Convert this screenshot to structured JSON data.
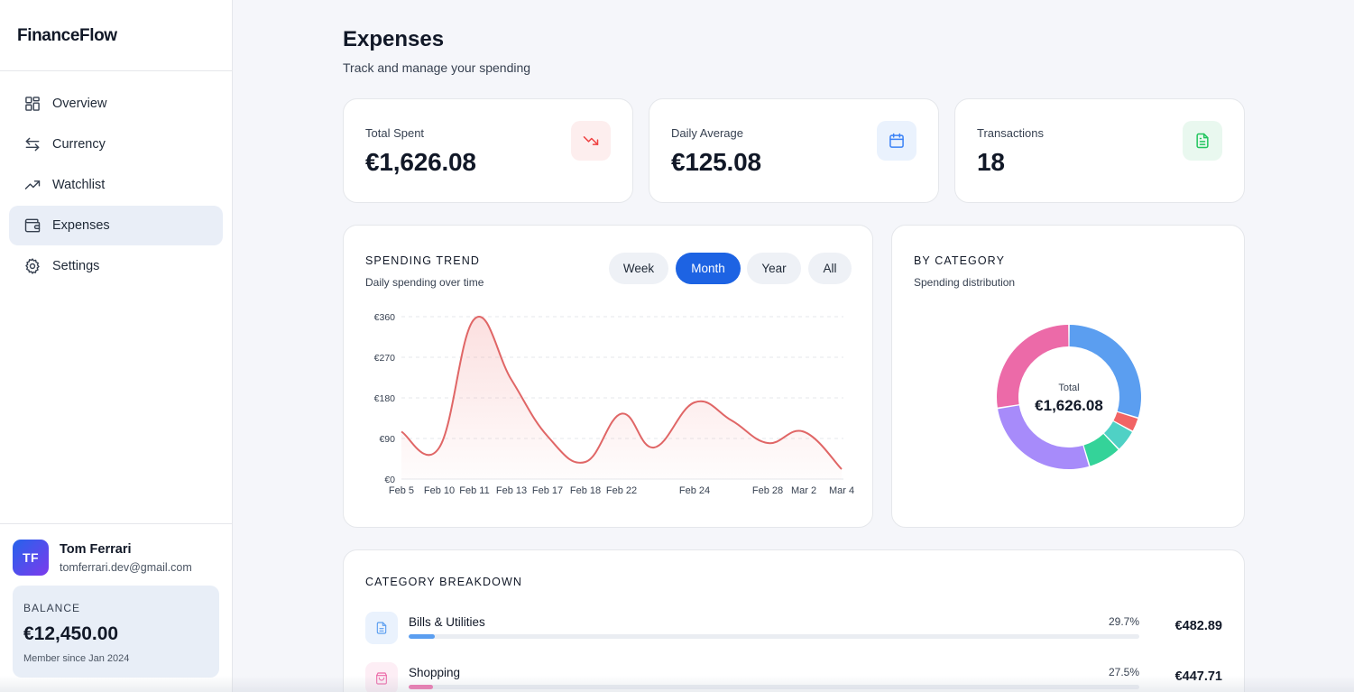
{
  "app": {
    "name": "FinanceFlow"
  },
  "nav": [
    {
      "label": "Overview",
      "icon": "grid-icon"
    },
    {
      "label": "Currency",
      "icon": "arrows-swap-icon"
    },
    {
      "label": "Watchlist",
      "icon": "trending-up-icon"
    },
    {
      "label": "Expenses",
      "icon": "wallet-icon",
      "active": true
    },
    {
      "label": "Settings",
      "icon": "gear-icon"
    }
  ],
  "user": {
    "initials": "TF",
    "name": "Tom Ferrari",
    "email": "tomferrari.dev@gmail.com",
    "balance_label": "BALANCE",
    "balance": "€12,450.00",
    "member_since": "Member since Jan 2024"
  },
  "page": {
    "title": "Expenses",
    "subtitle": "Track and manage your spending"
  },
  "stats": [
    {
      "label": "Total Spent",
      "value": "€1,626.08",
      "icon": "trending-down-icon",
      "color": "#ef4444",
      "bg": "#fdeeee"
    },
    {
      "label": "Daily Average",
      "value": "€125.08",
      "icon": "calendar-icon",
      "color": "#3b82f6",
      "bg": "#eaf2fd"
    },
    {
      "label": "Transactions",
      "value": "18",
      "icon": "document-icon",
      "color": "#22c55e",
      "bg": "#e9f8ef"
    }
  ],
  "trend": {
    "title": "SPENDING TREND",
    "subtitle": "Daily spending over time",
    "ranges": [
      {
        "label": "Week"
      },
      {
        "label": "Month",
        "active": true
      },
      {
        "label": "Year"
      },
      {
        "label": "All"
      }
    ]
  },
  "category": {
    "title": "BY CATEGORY",
    "subtitle": "Spending distribution",
    "center_label": "Total",
    "center_value": "€1,626.08"
  },
  "breakdown": {
    "title": "CATEGORY BREAKDOWN",
    "items": [
      {
        "name": "Bills & Utilities",
        "percent": "29.7%",
        "share": 0.297,
        "amount": "€482.89",
        "color": "#5b9ef0",
        "bg": "#eaf2fd",
        "icon": "document-icon"
      },
      {
        "name": "Shopping",
        "percent": "27.5%",
        "share": 0.275,
        "amount": "€447.71",
        "color": "#ec6aa8",
        "bg": "#fdeef5",
        "icon": "shopping-bag-icon"
      }
    ]
  },
  "chart_data": [
    {
      "type": "area",
      "title": "SPENDING TREND",
      "subtitle": "Daily spending over time",
      "x": [
        "Feb 5",
        "Feb 10",
        "Feb 11",
        "Feb 13",
        "Feb 17",
        "Feb 18",
        "Feb 22",
        "",
        "Feb 24",
        "",
        "Feb 28",
        "Mar 2",
        "Mar 4"
      ],
      "x_tick_labels": [
        "Feb 5",
        "Feb 10",
        "Feb 11",
        "Feb 13",
        "Feb 17",
        "Feb 18",
        "Feb 22",
        "Feb 24",
        "Feb 28",
        "Mar 2",
        "Mar 4"
      ],
      "series": [
        {
          "values": [
            105,
            70,
            355,
            220,
            95,
            38,
            145,
            70,
            170,
            130,
            80,
            105,
            22
          ]
        }
      ],
      "y_ticks": [
        "€0",
        "€90",
        "€180",
        "€270",
        "€360"
      ],
      "ylim": [
        0,
        360
      ],
      "grid": true,
      "line_color": "#e06666"
    },
    {
      "type": "pie",
      "title": "BY CATEGORY",
      "subtitle": "Spending distribution",
      "values": [
        29.7,
        3.2,
        5.0,
        7.5,
        27.1,
        27.5
      ],
      "colors": [
        "#5b9ef0",
        "#f16465",
        "#4fd1c5",
        "#34d399",
        "#a78bfa",
        "#ec6aa8"
      ],
      "center_label": "Total",
      "center_value": "€1,626.08"
    }
  ]
}
